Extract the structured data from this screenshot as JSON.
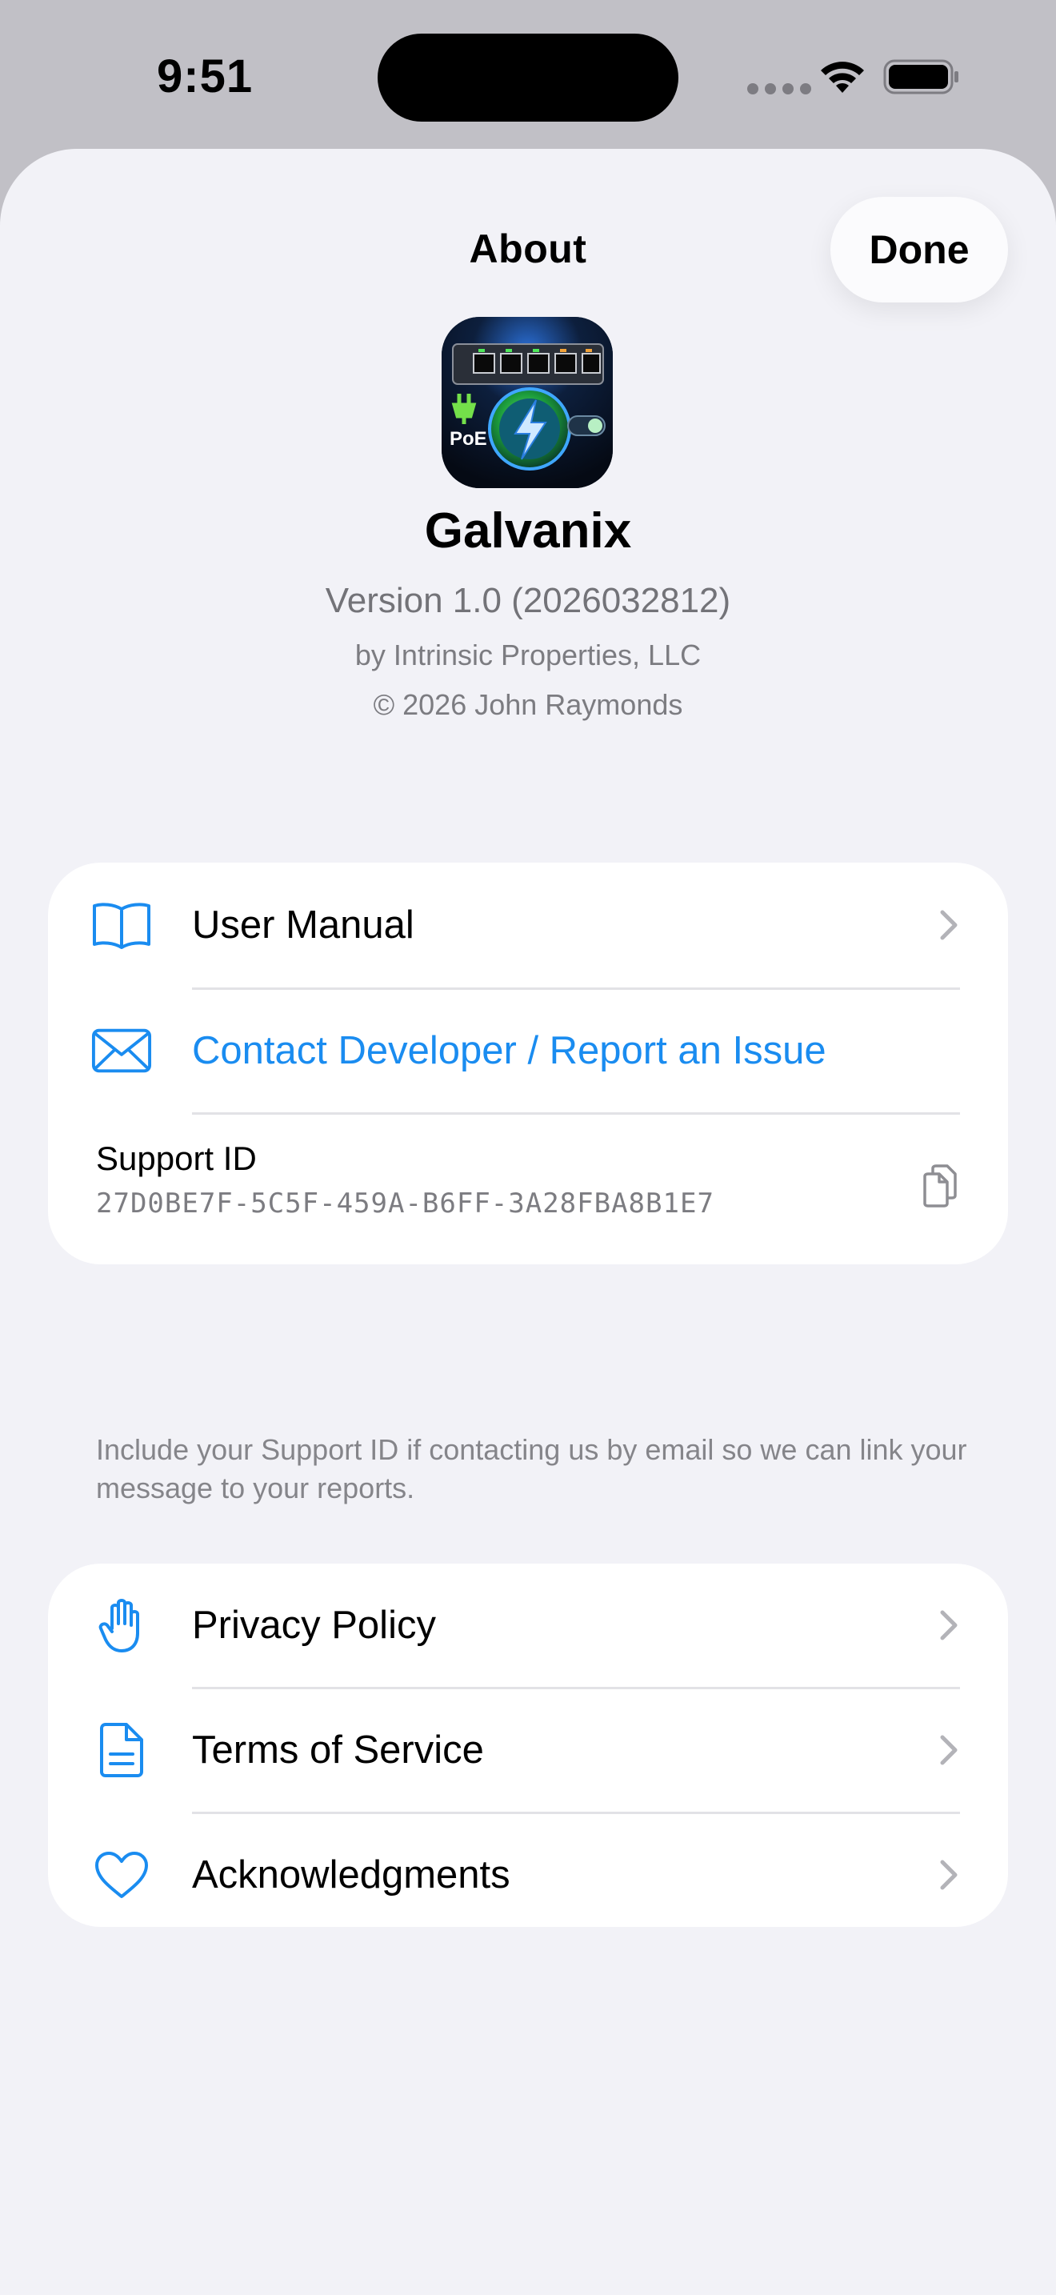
{
  "status_bar": {
    "time": "9:51"
  },
  "nav": {
    "title": "About",
    "done_label": "Done"
  },
  "app": {
    "name": "Galvanix",
    "version": "Version 1.0 (2026032812)",
    "company": "by Intrinsic Properties, LLC",
    "copyright": "© 2026 John Raymonds",
    "icon_badge": "PoE"
  },
  "links_section": {
    "user_manual": "User Manual",
    "contact": "Contact Developer / Report an Issue",
    "support_label": "Support ID",
    "support_id": "27D0BE7F-5C5F-459A-B6FF-3A28FBA8B1E7"
  },
  "support_note": "Include your Support ID if contacting us by email so we can link your message to your reports.",
  "legal_section": {
    "privacy": "Privacy Policy",
    "terms": "Terms of Service",
    "acknowledgments": "Acknowledgments"
  },
  "colors": {
    "accent": "#1a8cf0",
    "background": "#f2f2f7"
  }
}
